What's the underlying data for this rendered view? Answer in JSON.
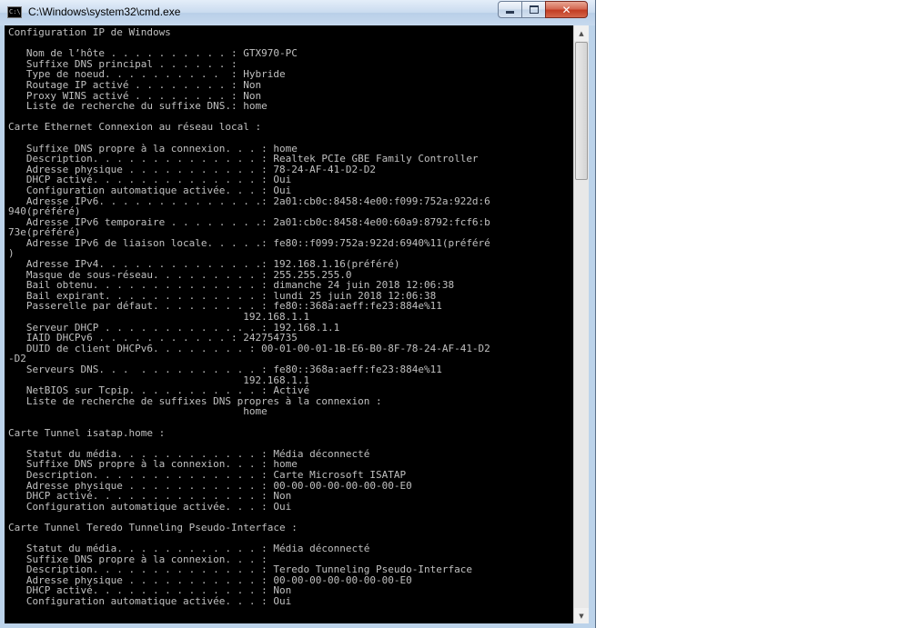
{
  "window": {
    "title": "C:\\Windows\\system32\\cmd.exe",
    "icon_label": "C:\\",
    "buttons": {
      "minimize": "minimize",
      "maximize": "maximize",
      "close": "✕"
    }
  },
  "console": {
    "lines": [
      "Configuration IP de Windows",
      "",
      "   Nom de l’hôte . . . . . . . . . . : GTX970-PC",
      "   Suffixe DNS principal . . . . . . :",
      "   Type de noeud. . . . . . . . . .  : Hybride",
      "   Routage IP activé . . . . . . . . : Non",
      "   Proxy WINS activé . . . . . . . . : Non",
      "   Liste de recherche du suffixe DNS.: home",
      "",
      "Carte Ethernet Connexion au réseau local :",
      "",
      "   Suffixe DNS propre à la connexion. . . : home",
      "   Description. . . . . . . . . . . . . . : Realtek PCIe GBE Family Controller",
      "   Adresse physique . . . . . . . . . . . : 78-24-AF-41-D2-D2",
      "   DHCP activé. . . . . . . . . . . . . . : Oui",
      "   Configuration automatique activée. . . : Oui",
      "   Adresse IPv6. . . . . . . . . . . . . .: 2a01:cb0c:8458:4e00:f099:752a:922d:6",
      "940(préféré)",
      "   Adresse IPv6 temporaire . . . . . . . .: 2a01:cb0c:8458:4e00:60a9:8792:fcf6:b",
      "73e(préféré)",
      "   Adresse IPv6 de liaison locale. . . . .: fe80::f099:752a:922d:6940%11(préféré",
      ")",
      "   Adresse IPv4. . . . . . . . . . . . . .: 192.168.1.16(préféré)",
      "   Masque de sous-réseau. . . . . . . . . : 255.255.255.0",
      "   Bail obtenu. . . . . . . . . . . . . . : dimanche 24 juin 2018 12:06:38",
      "   Bail expirant. . . . . . . . . . . . . : lundi 25 juin 2018 12:06:38",
      "   Passerelle par défaut. . . . . . . . . : fe80::368a:aeff:fe23:884e%11",
      "                                       192.168.1.1",
      "   Serveur DHCP . . . . . . . . . . . . . : 192.168.1.1",
      "   IAID DHCPv6 . . . . . . . . . . . : 242754735",
      "   DUID de client DHCPv6. . . . . . . . : 00-01-00-01-1B-E6-B0-8F-78-24-AF-41-D2",
      "-D2",
      "   Serveurs DNS. . .  . . . . . . . . . . : fe80::368a:aeff:fe23:884e%11",
      "                                       192.168.1.1",
      "   NetBIOS sur Tcpip. . . . . . . . . . . : Activé",
      "   Liste de recherche de suffixes DNS propres à la connexion :",
      "                                       home",
      "",
      "Carte Tunnel isatap.home :",
      "",
      "   Statut du média. . . . . . . . . . . . : Média déconnecté",
      "   Suffixe DNS propre à la connexion. . . : home",
      "   Description. . . . . . . . . . . . . . : Carte Microsoft ISATAP",
      "   Adresse physique . . . . . . . . . . . : 00-00-00-00-00-00-00-E0",
      "   DHCP activé. . . . . . . . . . . . . . : Non",
      "   Configuration automatique activée. . . : Oui",
      "",
      "Carte Tunnel Teredo Tunneling Pseudo-Interface :",
      "",
      "   Statut du média. . . . . . . . . . . . : Média déconnecté",
      "   Suffixe DNS propre à la connexion. . . :",
      "   Description. . . . . . . . . . . . . . : Teredo Tunneling Pseudo-Interface",
      "   Adresse physique . . . . . . . . . . . : 00-00-00-00-00-00-00-E0",
      "   DHCP activé. . . . . . . . . . . . . . : Non",
      "   Configuration automatique activée. . . : Oui"
    ]
  },
  "scrollbar": {
    "up_icon": "▲",
    "down_icon": "▼",
    "position_fraction": 0
  }
}
